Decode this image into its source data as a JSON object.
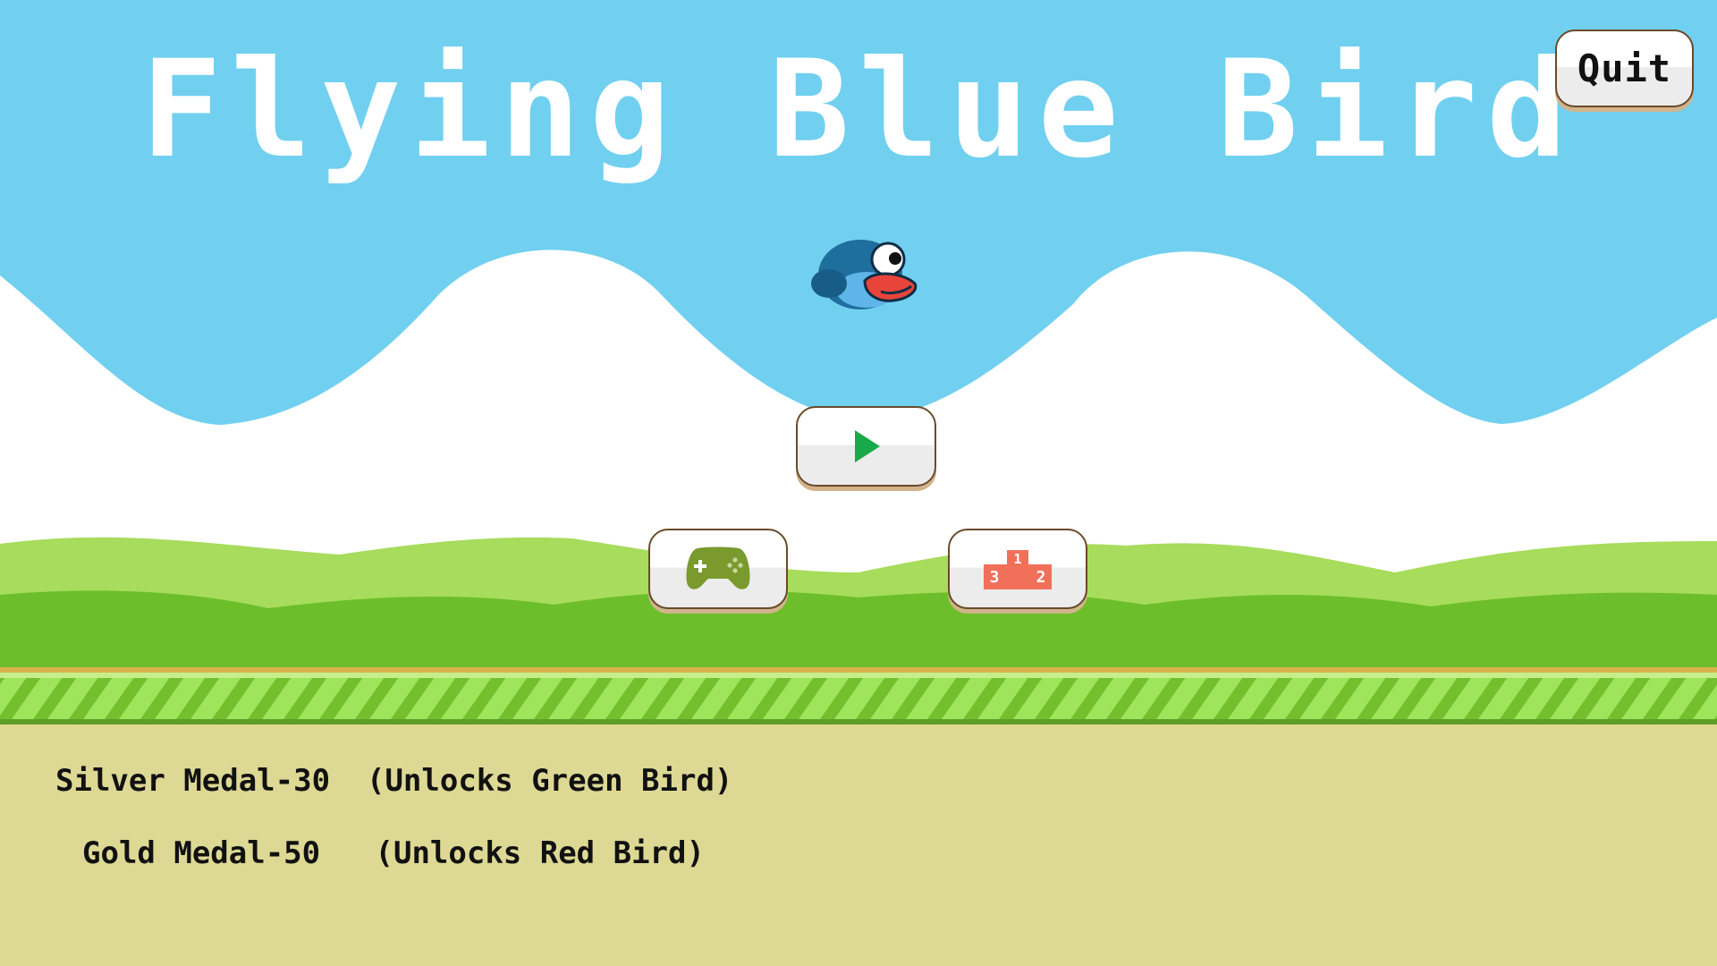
{
  "title": "Flying Blue Bird",
  "buttons": {
    "quit_label": "Quit",
    "play_icon": "play-icon",
    "games_icon": "gamepad-icon",
    "leaderboard_icon": "podium-icon"
  },
  "medals": {
    "silver": "Silver Medal-30  (Unlocks Green Bird)",
    "gold": "Gold Medal-50   (Unlocks Red Bird)"
  },
  "podium": {
    "first": "1",
    "second": "2",
    "third": "3"
  },
  "colors": {
    "sky": "#71d0ef",
    "clouds": "#ffffff",
    "hills_light": "#a7dc5c",
    "hills_dark": "#6cbf2a",
    "ground_stripe_light": "#9ee55c",
    "ground_stripe_dark": "#73bf2e",
    "dirt": "#ddd894",
    "play_icon": "#1aa94a",
    "gamepad_icon": "#7b9a2e",
    "podium_icon": "#f0705a",
    "bird_body": "#1e6e9e"
  }
}
